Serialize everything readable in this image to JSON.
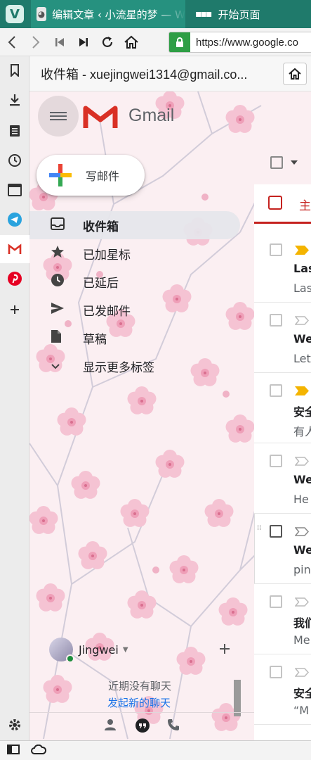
{
  "browser": {
    "tabs": [
      {
        "title": "编辑文章 ‹ 小流星的梦 — W"
      },
      {
        "title": "开始页面"
      }
    ],
    "url": "https://www.google.co"
  },
  "panel": {
    "title": "收件箱 - xuejingwei1314@gmail.co..."
  },
  "gmail": {
    "logo_text": "Gmail",
    "compose_label": "写邮件",
    "nav": [
      {
        "label": "收件箱",
        "icon": "inbox-icon",
        "active": true
      },
      {
        "label": "已加星标",
        "icon": "star-icon"
      },
      {
        "label": "已延后",
        "icon": "clock-icon"
      },
      {
        "label": "已发邮件",
        "icon": "send-icon"
      },
      {
        "label": "草稿",
        "icon": "draft-icon"
      },
      {
        "label": "显示更多标签",
        "icon": "chevron-down-icon"
      }
    ],
    "category_tab": "主",
    "mails": [
      {
        "sender": "Las",
        "snippet": "Las",
        "important": true
      },
      {
        "sender": "We",
        "snippet": "Let",
        "important": false
      },
      {
        "sender": "安全",
        "snippet": "有人",
        "important": true
      },
      {
        "sender": "We",
        "snippet": "He",
        "important": false
      },
      {
        "sender": "We",
        "snippet": "pin",
        "important": false
      },
      {
        "sender": "我们",
        "snippet": "Me",
        "important": false
      },
      {
        "sender": "安全",
        "snippet": "“M",
        "important": false
      }
    ],
    "chat": {
      "user": "Jingwei",
      "no_chats": "近期没有聊天",
      "start_chat": "发起新的聊天"
    }
  },
  "colors": {
    "browser_accent": "#1f7a6b",
    "gmail_red": "#c5221f",
    "important_yellow": "#f4b400"
  }
}
